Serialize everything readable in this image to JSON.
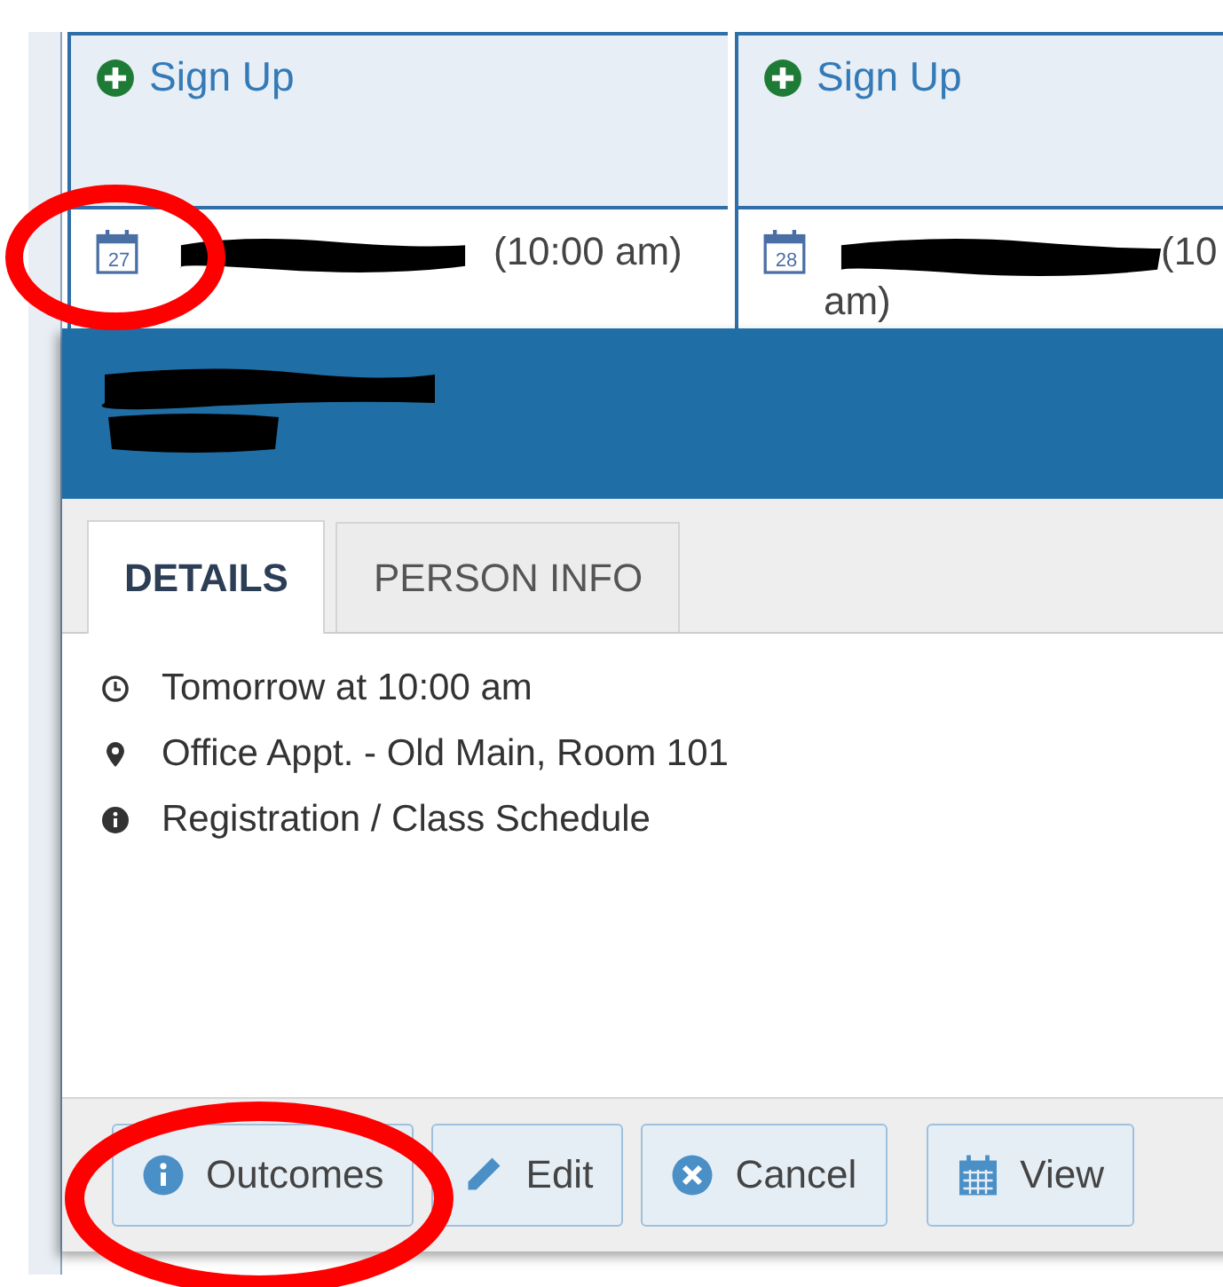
{
  "calendar": {
    "days": [
      {
        "sign_up": "Sign Up",
        "appointment": {
          "date": "27",
          "time_lines": [
            "(10:00 am)"
          ]
        }
      },
      {
        "sign_up": "Sign Up",
        "appointment": {
          "date": "28",
          "time_lines": [
            "(10",
            "am)"
          ]
        }
      }
    ]
  },
  "dialog": {
    "tabs": [
      {
        "label": "DETAILS",
        "selected": true
      },
      {
        "label": "PERSON INFO",
        "selected": false
      }
    ],
    "details": [
      {
        "kind": "time",
        "text": "Tomorrow at 10:00 am"
      },
      {
        "kind": "location",
        "text": "Office Appt. - Old Main, Room 101"
      },
      {
        "kind": "info",
        "text": "Registration / Class Schedule"
      }
    ],
    "buttons": [
      {
        "kind": "info",
        "label": "Outcomes"
      },
      {
        "kind": "edit",
        "label": "Edit"
      },
      {
        "kind": "cancel",
        "label": "Cancel"
      },
      {
        "kind": "calendar",
        "label": "View"
      }
    ]
  }
}
